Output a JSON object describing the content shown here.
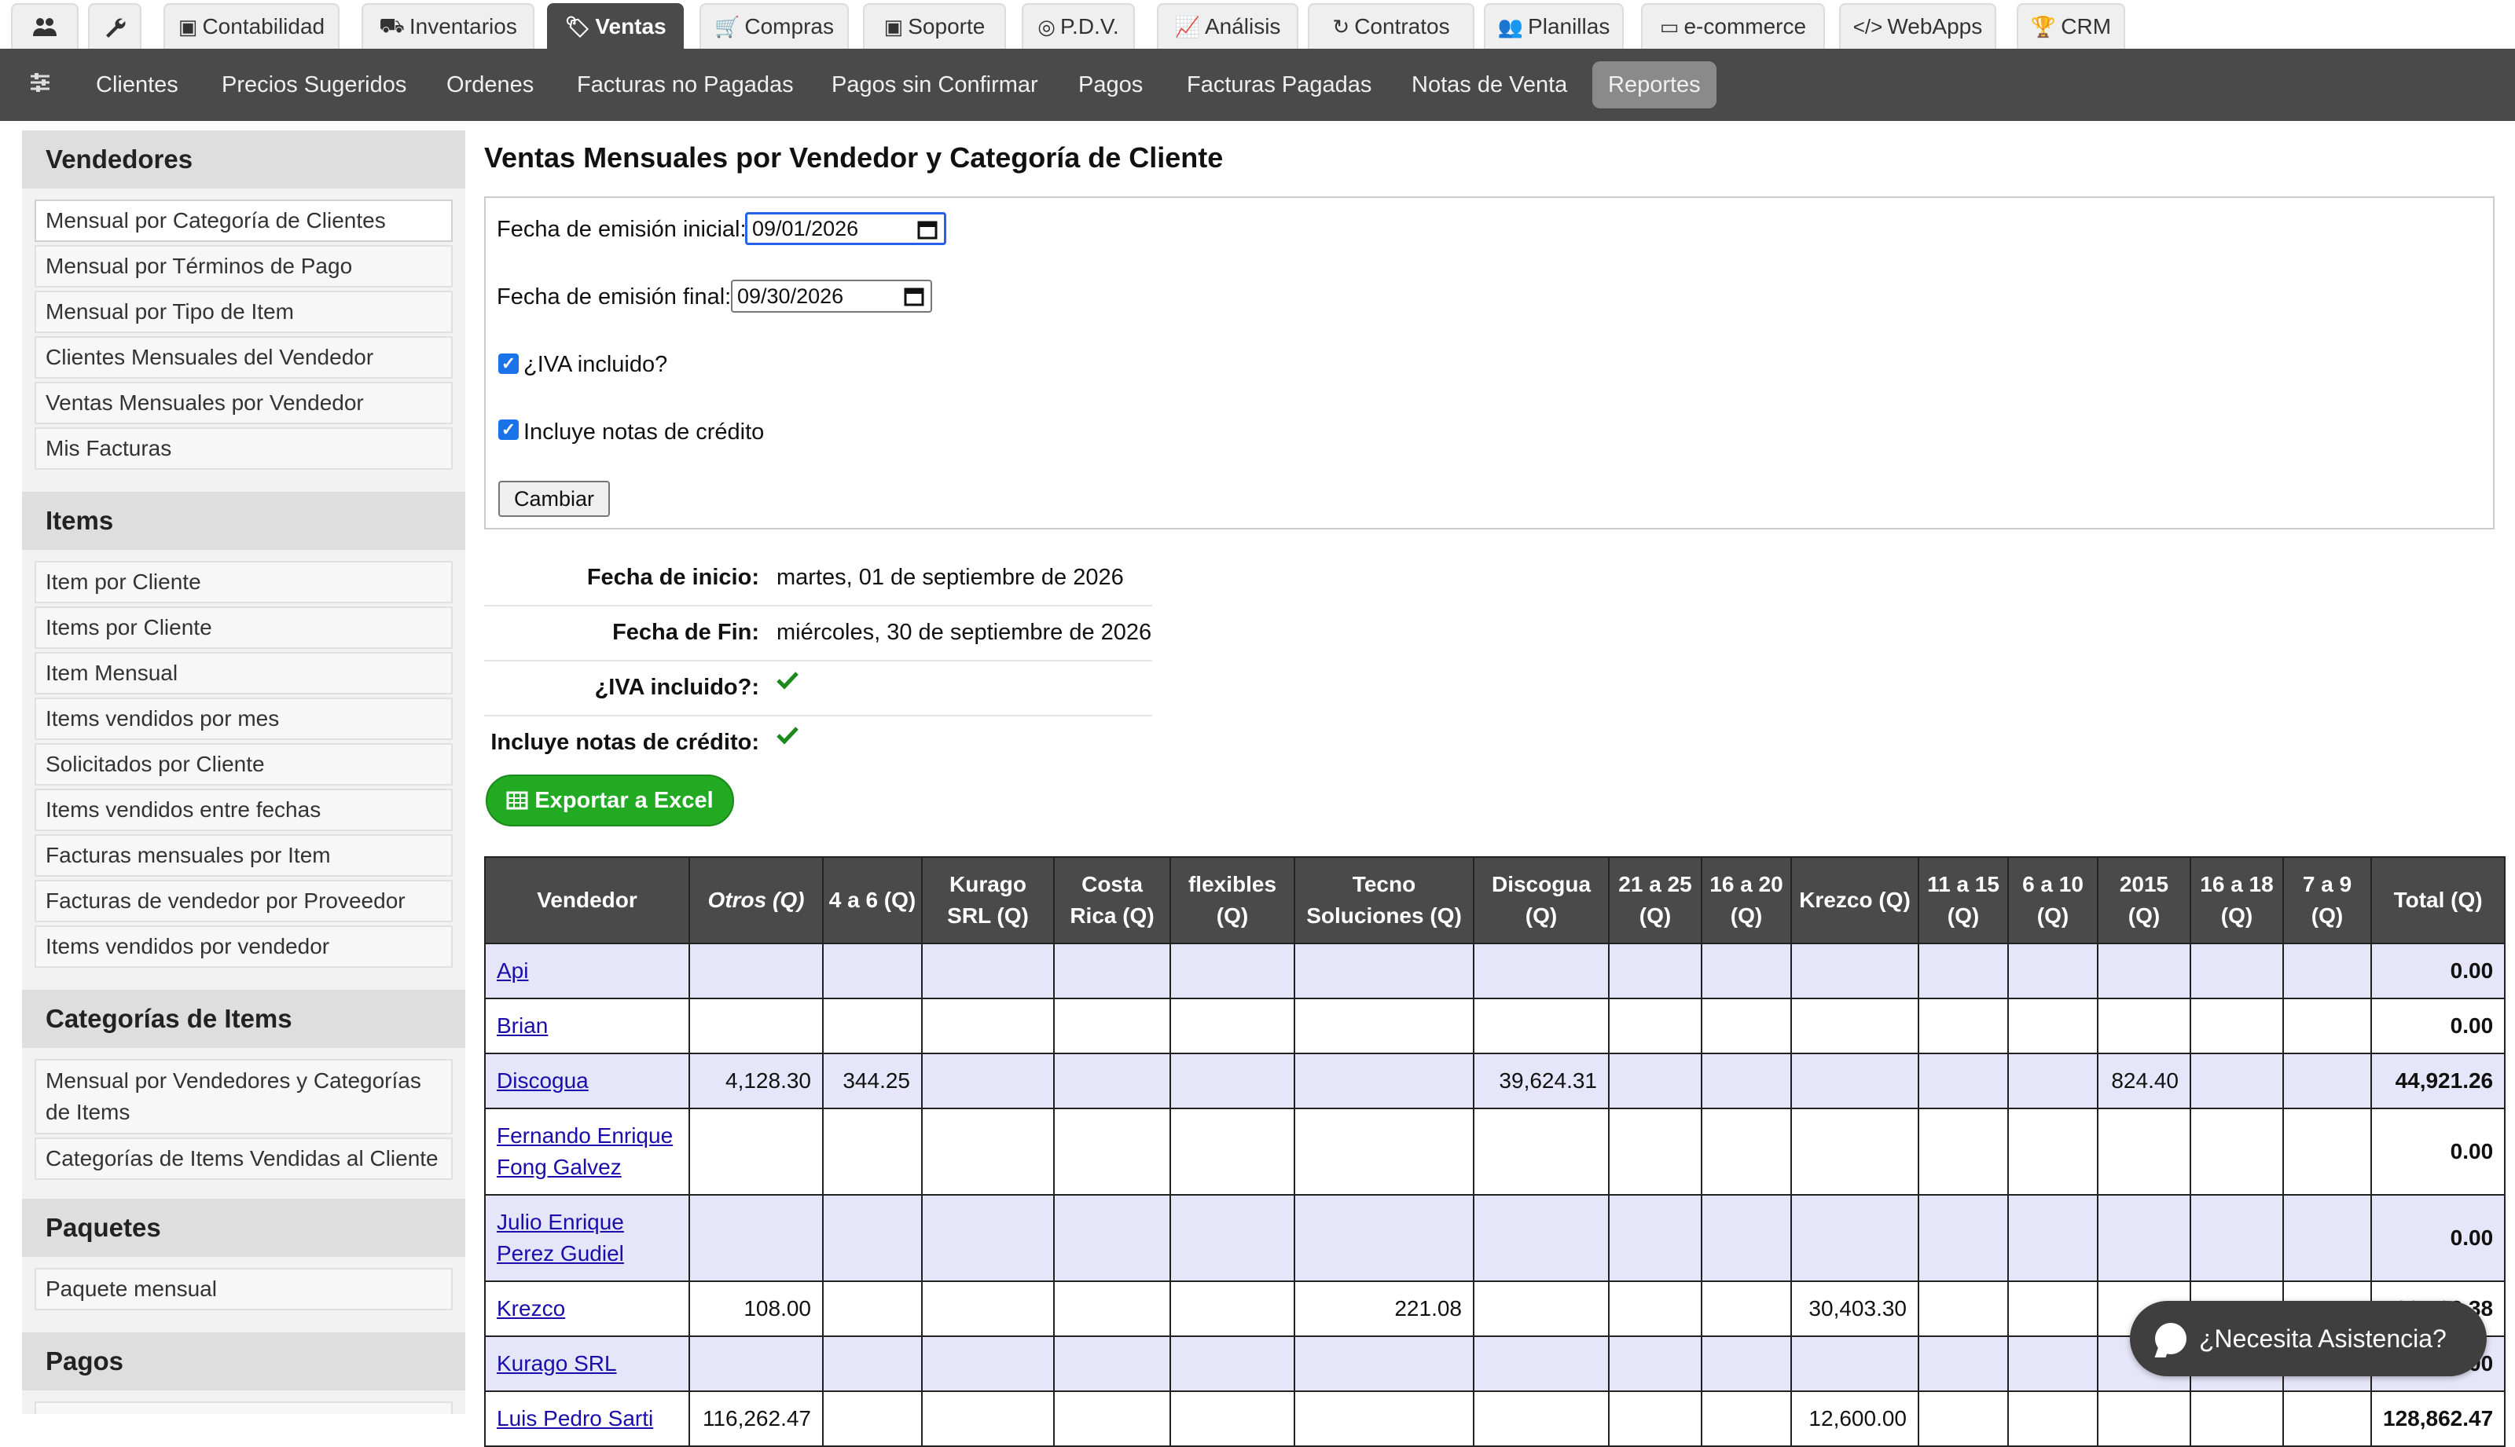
{
  "top_tabs": [
    {
      "label": "",
      "icon": "users-icon"
    },
    {
      "label": "",
      "icon": "wrench-icon"
    },
    {
      "label": "Contabilidad",
      "icon": "money-icon"
    },
    {
      "label": "Inventarios",
      "icon": "truck-icon"
    },
    {
      "label": "Ventas",
      "icon": "tags-icon",
      "active": true
    },
    {
      "label": "Compras",
      "icon": "cart-icon"
    },
    {
      "label": "Soporte",
      "icon": "medkit-icon"
    },
    {
      "label": "P.D.V.",
      "icon": "target-icon"
    },
    {
      "label": "Análisis",
      "icon": "line-chart-icon"
    },
    {
      "label": "Contratos",
      "icon": "refresh-icon"
    },
    {
      "label": "Planillas",
      "icon": "users-icon"
    },
    {
      "label": "e-commerce",
      "icon": "credit-card-icon"
    },
    {
      "label": "WebApps",
      "icon": "code-icon"
    },
    {
      "label": "CRM",
      "icon": "trophy-icon"
    }
  ],
  "sub_tabs": [
    "Clientes",
    "Precios Sugeridos",
    "Ordenes",
    "Facturas no Pagadas",
    "Pagos sin Confirmar",
    "Pagos",
    "Facturas Pagadas",
    "Notas de Venta",
    "Reportes"
  ],
  "sidebar": {
    "sections": [
      {
        "title": "Vendedores",
        "items": [
          "Mensual por Categoría de Clientes",
          "Mensual por Términos de Pago",
          "Mensual por Tipo de Item",
          "Clientes Mensuales del Vendedor",
          "Ventas Mensuales por Vendedor",
          "Mis Facturas"
        ]
      },
      {
        "title": "Items",
        "items": [
          "Item por Cliente",
          "Items por Cliente",
          "Item Mensual",
          "Items vendidos por mes",
          "Solicitados por Cliente",
          "Items vendidos entre fechas",
          "Facturas mensuales por Item",
          "Facturas de vendedor por Proveedor",
          "Items vendidos por vendedor"
        ]
      },
      {
        "title": "Categorías de Items",
        "items": [
          "Mensual por Vendedores y Categorías de Items",
          "Categorías de Items Vendidas al Cliente"
        ]
      },
      {
        "title": "Paquetes",
        "items": [
          "Paquete mensual"
        ]
      },
      {
        "title": "Pagos",
        "items": [
          ""
        ]
      }
    ]
  },
  "main": {
    "title": "Ventas Mensuales por Vendedor y Categoría de Cliente",
    "form": {
      "start_label": "Fecha de emisión inicial:",
      "start_value": "09/01/2026",
      "end_label": "Fecha de emisión final:",
      "end_value": "09/30/2026",
      "iva_label": "¿IVA incluido?",
      "credit_label": "Incluye notas de crédito",
      "submit_label": "Cambiar"
    },
    "summary": [
      {
        "label": "Fecha de inicio:",
        "value": "martes, 01 de septiembre de 2026"
      },
      {
        "label": "Fecha de Fin:",
        "value": "miércoles, 30 de septiembre de 2026"
      },
      {
        "label": "¿IVA incluido?:",
        "value": "",
        "check": true
      },
      {
        "label": "Incluye notas de crédito:",
        "value": "",
        "check": true
      }
    ],
    "export_label": "Exportar a Excel"
  },
  "table": {
    "headers": [
      "Vendedor",
      "Otros (Q)",
      "4 a 6 (Q)",
      "Kurago SRL (Q)",
      "Costa Rica (Q)",
      "flexibles (Q)",
      "Tecno Soluciones (Q)",
      "Discogua (Q)",
      "21 a 25 (Q)",
      "16 a 20 (Q)",
      "Krezco (Q)",
      "11 a 15 (Q)",
      "6 a 10 (Q)",
      "2015 (Q)",
      "16 a 18 (Q)",
      "7 a 9 (Q)",
      "Total (Q)"
    ],
    "rows": [
      {
        "vendor": "Api",
        "cells": [
          "",
          "",
          "",
          "",
          "",
          "",
          "",
          "",
          "",
          "",
          "",
          "",
          "",
          "",
          ""
        ],
        "total": "0.00"
      },
      {
        "vendor": "Brian",
        "cells": [
          "",
          "",
          "",
          "",
          "",
          "",
          "",
          "",
          "",
          "",
          "",
          "",
          "",
          "",
          ""
        ],
        "total": "0.00"
      },
      {
        "vendor": "Discogua",
        "cells": [
          "4,128.30",
          "344.25",
          "",
          "",
          "",
          "",
          "39,624.31",
          "",
          "",
          "",
          "",
          "",
          "824.40",
          "",
          ""
        ],
        "total": "44,921.26"
      },
      {
        "vendor": "Fernando Enrique Fong Galvez",
        "cells": [
          "",
          "",
          "",
          "",
          "",
          "",
          "",
          "",
          "",
          "",
          "",
          "",
          "",
          "",
          ""
        ],
        "total": "0.00"
      },
      {
        "vendor": "Julio Enrique Perez Gudiel",
        "cells": [
          "",
          "",
          "",
          "",
          "",
          "",
          "",
          "",
          "",
          "",
          "",
          "",
          "",
          "",
          ""
        ],
        "total": "0.00"
      },
      {
        "vendor": "Krezco",
        "cells": [
          "108.00",
          "",
          "",
          "",
          "",
          "221.08",
          "",
          "",
          "",
          "30,403.30",
          "",
          "",
          "",
          "",
          ""
        ],
        "total": "30,732.38"
      },
      {
        "vendor": "Kurago SRL",
        "cells": [
          "",
          "",
          "",
          "",
          "",
          "",
          "",
          "",
          "",
          "",
          "",
          "",
          "",
          "",
          ""
        ],
        "total": "0.00"
      },
      {
        "vendor": "Luis Pedro Sarti",
        "cells": [
          "116,262.47",
          "",
          "",
          "",
          "",
          "",
          "",
          "",
          "",
          "12,600.00",
          "",
          "",
          "",
          "",
          ""
        ],
        "total": "128,862.47"
      }
    ]
  },
  "assist_label": "¿Necesita Asistencia?"
}
